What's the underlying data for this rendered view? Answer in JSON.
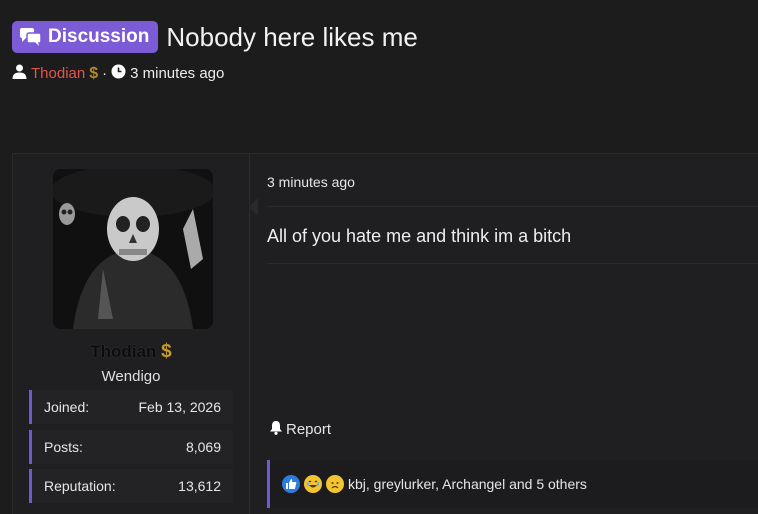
{
  "thread": {
    "prefix": "Discussion",
    "title": "Nobody here likes me",
    "author": "Thodian",
    "dot": "·",
    "time": "3 minutes ago"
  },
  "user": {
    "name": "Thodian",
    "title": "Wendigo",
    "stats": [
      {
        "label": "Joined:",
        "value": "Feb 13, 2026"
      },
      {
        "label": "Posts:",
        "value": "8,069"
      },
      {
        "label": "Reputation:",
        "value": "13,612"
      }
    ]
  },
  "post": {
    "time": "3 minutes ago",
    "body": "All of you hate me and think im a bitch",
    "report_label": "Report",
    "reactions_text": "kbj, greylurker, Archangel and 5 others"
  },
  "icons": {
    "prefix": "chat-bubbles-icon",
    "author": "user-icon",
    "time": "clock-icon",
    "report": "bell-icon",
    "reactions": [
      "like-icon",
      "laugh-icon",
      "sad-icon"
    ],
    "badge": "dollar-icon"
  },
  "colors": {
    "accent": "#7b5bd6",
    "author_name": "#e4544a",
    "background": "#1c1c1d"
  }
}
